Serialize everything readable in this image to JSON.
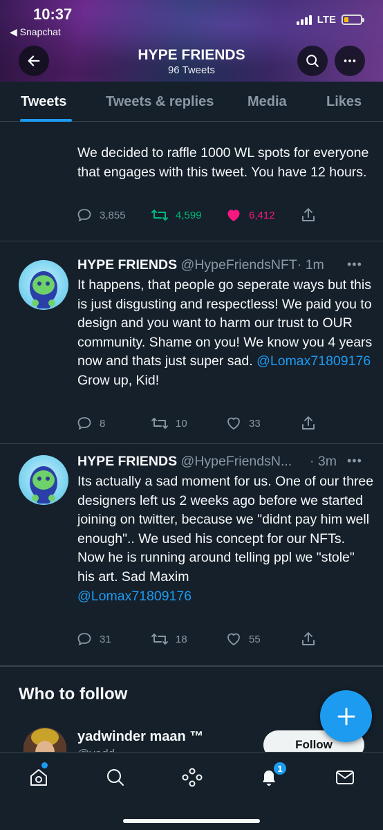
{
  "status_bar": {
    "time": "10:37",
    "back_app": "◀ Snapchat",
    "network": "LTE"
  },
  "header": {
    "title": "HYPE FRIENDS",
    "subtitle": "96 Tweets"
  },
  "tabs": [
    {
      "label": "Tweets",
      "active": true
    },
    {
      "label": "Tweets & replies",
      "active": false
    },
    {
      "label": "Media",
      "active": false
    },
    {
      "label": "Likes",
      "active": false
    }
  ],
  "pinned_tweet": {
    "text": "We decided to raffle 1000 WL spots for everyone that engages with this tweet. You have 12 hours.",
    "replies": "3,855",
    "retweets": "4,599",
    "likes": "6,412",
    "liked": true
  },
  "tweets": [
    {
      "name": "HYPE FRIENDS",
      "handle": "@HypeFriendsNFT",
      "time": "· 1m",
      "text": "It happens, that people go seperate ways but this is just disgusting and respectless! We paid you to design and you want to harm our trust to OUR community. Shame on you! We know you 4 years now and thats just super sad.",
      "mention": "@Lomax71809176",
      "text_after": "Grow up, Kid!",
      "replies": "8",
      "retweets": "10",
      "likes": "33"
    },
    {
      "name": "HYPE FRIENDS",
      "handle": "@HypeFriendsN...",
      "time": "· 3m",
      "text": "Its actually a sad moment for us. One of our three designers left us 2 weeks ago before we started joining on twitter, because we \"didnt pay him well enough\".. We used his concept for our NFTs. Now he is running around telling ppl we \"stole\" his art. Sad Maxim",
      "mention": "@Lomax71809176",
      "replies": "31",
      "retweets": "18",
      "likes": "55"
    }
  ],
  "who_to_follow": {
    "title": "Who to follow",
    "name": "yadwinder maan ™",
    "handle": "@yadd...",
    "follow_label": "Follow"
  },
  "bottom_nav": {
    "notifications_badge": "1"
  },
  "colors": {
    "background": "#15202b",
    "accent": "#1d9bf0",
    "muted": "#8b98a5",
    "retweet_green": "#00ba7c",
    "like_pink": "#f91880"
  }
}
